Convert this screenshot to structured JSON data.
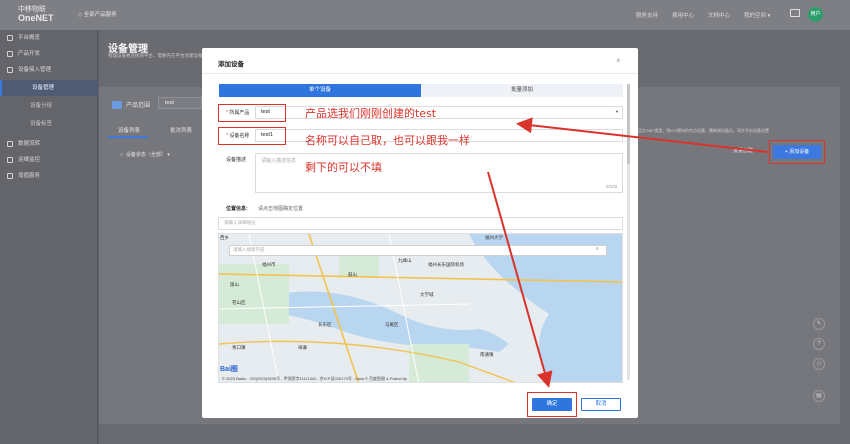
{
  "topbar": {
    "logo_line1": "中移物联",
    "logo_line2": "OneNET",
    "home_link": "全部产品服务",
    "nav": [
      "服务支持",
      "费用中心",
      "文档中心",
      "我的空间"
    ],
    "avatar": "用户"
  },
  "sidebar": {
    "items": [
      {
        "label": "平台概览",
        "sub": false,
        "active": false
      },
      {
        "label": "产品开发",
        "sub": false,
        "active": false
      },
      {
        "label": "设备接入管理",
        "sub": false,
        "active": false
      },
      {
        "label": "设备管理",
        "sub": true,
        "active": true
      },
      {
        "label": "设备分组",
        "sub": true,
        "active": false
      },
      {
        "label": "设备标签",
        "sub": true,
        "active": false
      },
      {
        "label": "数据流转",
        "sub": false,
        "active": false
      },
      {
        "label": "运维监控",
        "sub": false,
        "active": false
      },
      {
        "label": "增值服务",
        "sub": false,
        "active": false
      }
    ]
  },
  "main": {
    "title": "设备管理",
    "description": "物理设备要连接到平台，需要先在平台创建设备",
    "product_label": "产品范围",
    "product_value": "test",
    "tabs": [
      "设备列表",
      "批次列表"
    ],
    "status_filter": "设备状态（全部）",
    "right_hint": "若产品为\"NB\"类型，则IOT模块的节点设备、需新增设备后，同步开启设备设置",
    "batch_button": "批量创建",
    "add_device_button": "+ 添加设备"
  },
  "dialog": {
    "title": "添加设备",
    "close": "×",
    "tab_single": "单个设备",
    "tab_batch": "批量添加",
    "product_label": "所属产品",
    "product_value": "test",
    "device_name_label": "设备名称",
    "device_name_value": "test1",
    "desc_label": "设备描述",
    "desc_placeholder": "请输入描述信息",
    "desc_count": "0/100",
    "location_label": "位置信息:",
    "location_hint": "请点击地图确定位置",
    "location_placeholder": "请输入详细地址",
    "map_search_placeholder": "请输入搜索内容",
    "map_labels": [
      "西乡",
      "福州大学",
      "九峰山",
      "福州市",
      "大学城",
      "苍山区",
      "长乐区",
      "马尾区",
      "福州长乐国际机场",
      "鼓山",
      "旗山",
      "南通镇",
      "祥谦",
      "青口镇"
    ],
    "map_brand": "Bai图",
    "map_copyright": "© 2023 Baidu - GS(2023)3206号 - 甲测资字11111342 - 京ICP证030173号 - Data © 百度智图 & PaleoCity",
    "ok_button": "确定",
    "cancel_button": "取消"
  },
  "annotations": {
    "note_product": "产品选我们刚刚创建的test",
    "note_name": "名称可以自己取，也可以跟我一样",
    "note_rest": "剩下的可以不填"
  },
  "colors": {
    "primary": "#2e75de",
    "annotation_red": "#d9332b",
    "overlay": "#6a6b70"
  }
}
